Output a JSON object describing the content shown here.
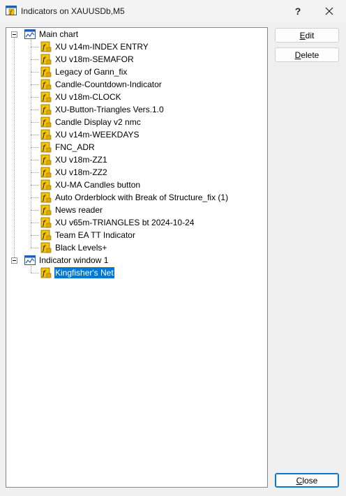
{
  "window": {
    "title": "Indicators on XAUUSDb,M5",
    "help_label": "?"
  },
  "tree": {
    "groups": [
      {
        "label": "Main chart",
        "items": [
          "XU v14m-INDEX ENTRY",
          "XU v18m-SEMAFOR",
          "Legacy of Gann_fix",
          "Candle-Countdown-Indicator",
          "XU v18m-CLOCK",
          "XU-Button-Triangles Vers.1.0",
          "Candle Display v2 nmc",
          "XU v14m-WEEKDAYS",
          "FNC_ADR",
          "XU v18m-ZZ1",
          "XU v18m-ZZ2",
          "XU-MA Candles button",
          "Auto Orderblock with Break of Structure_fix (1)",
          "News reader",
          "XU v65m-TRIANGLES bt 2024-10-24",
          "Team EA TT Indicator",
          "Black Levels+"
        ]
      },
      {
        "label": "Indicator window 1",
        "items": [
          "Kingfisher's Net"
        ]
      }
    ],
    "selected_item": "Kingfisher's Net"
  },
  "buttons": {
    "edit": {
      "first": "E",
      "rest": "dit"
    },
    "delete": {
      "first": "D",
      "rest": "elete"
    },
    "close": {
      "first": "C",
      "rest": "lose"
    }
  },
  "colors": {
    "selection": "#0078d7",
    "icon_yellow": "#f5c400",
    "chart_icon_blue": "#1e5fb4"
  }
}
